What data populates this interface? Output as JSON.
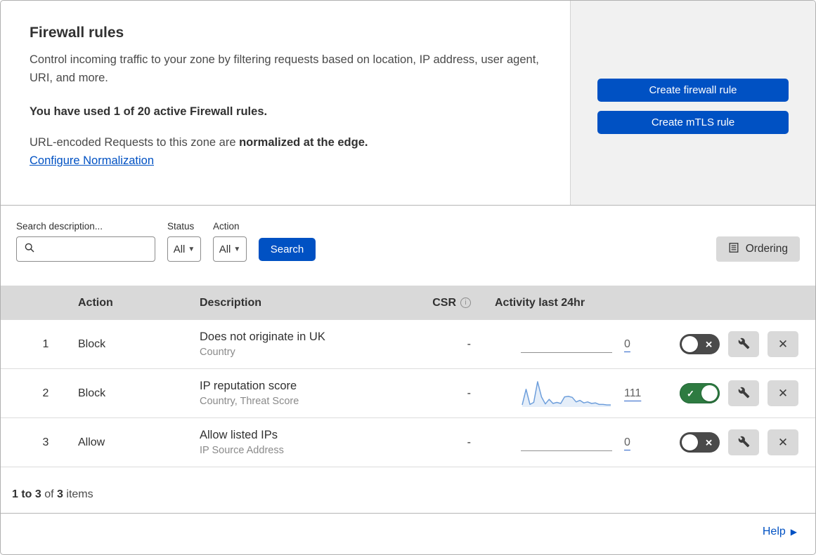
{
  "hero": {
    "title": "Firewall rules",
    "description": "Control incoming traffic to your zone by filtering requests based on location, IP address, user agent, URI, and more.",
    "usage": "You have used 1 of 20 active Firewall rules.",
    "normalization_prefix": "URL-encoded Requests to this zone are ",
    "normalization_bold": "normalized at the edge.",
    "normalization_link": "Configure Normalization",
    "buttons": {
      "create_firewall": "Create firewall rule",
      "create_mtls": "Create mTLS rule"
    }
  },
  "filters": {
    "search_label": "Search description...",
    "search_value": "",
    "status_label": "Status",
    "status_value": "All",
    "action_label": "Action",
    "action_value": "All",
    "search_button": "Search",
    "ordering_button": "Ordering"
  },
  "table": {
    "headers": {
      "action": "Action",
      "description": "Description",
      "csr": "CSR",
      "activity": "Activity last 24hr"
    },
    "rows": [
      {
        "priority": "1",
        "action": "Block",
        "description": "Does not originate in UK",
        "fields": "Country",
        "csr": "-",
        "activity_count": "0",
        "enabled": false,
        "sparkline": []
      },
      {
        "priority": "2",
        "action": "Block",
        "description": "IP reputation score",
        "fields": "Country, Threat Score",
        "csr": "-",
        "activity_count": "111",
        "enabled": true,
        "sparkline": [
          8,
          70,
          10,
          18,
          100,
          40,
          12,
          30,
          14,
          18,
          14,
          40,
          42,
          38,
          20,
          26,
          16,
          20,
          14,
          16,
          10,
          10,
          8,
          8
        ]
      },
      {
        "priority": "3",
        "action": "Allow",
        "description": "Allow listed IPs",
        "fields": "IP Source Address",
        "csr": "-",
        "activity_count": "0",
        "enabled": false,
        "sparkline": []
      }
    ]
  },
  "footer": {
    "range": "1 to 3",
    "of": " of ",
    "total": "3",
    "items": " items",
    "help_label": "Help"
  },
  "colors": {
    "accent_blue": "#0051c3",
    "toggle_on_green": "#2e7b41",
    "toggle_off_gray": "#4a4a4a",
    "sparkline_stroke": "#6d9edb",
    "sparkline_fill": "rgba(109,158,219,0.18)",
    "header_gray": "#d9d9d9"
  }
}
